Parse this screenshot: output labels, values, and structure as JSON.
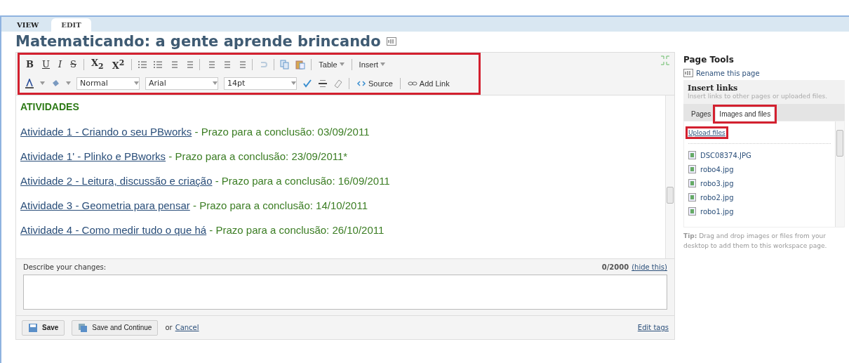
{
  "tabs": [
    {
      "label": "VIEW",
      "selected": false
    },
    {
      "label": "EDIT",
      "selected": true
    }
  ],
  "page_title": "Matematicando: a gente aprende brincando",
  "toolbar": {
    "highlighted": true,
    "format_buttons": [
      "B",
      "U",
      "I",
      "S"
    ],
    "script_buttons": [
      "X$_{2}$",
      "X$^{2}$"
    ],
    "menus": [
      "Table",
      "Insert"
    ],
    "selects": [
      {
        "value": "Normal"
      },
      {
        "value": "Arial"
      },
      {
        "value": "14pt"
      }
    ],
    "text_buttons": [
      "Source",
      "Add Link"
    ]
  },
  "content": {
    "heading": "ATIVIDADES",
    "activities": [
      {
        "link": "Atividade 1 - Criando o seu PBworks",
        "rest": " - Prazo para a conclusão: 03/09/2011"
      },
      {
        "link": "Atividade 1' - Plinko e PBworks",
        "rest": " - Prazo para a conclusão: 23/09/2011*"
      },
      {
        "link": "Atividade 2 - Leitura, discussão e criação",
        "rest": " -  Prazo para a conclusão: 16/09/2011"
      },
      {
        "link": "Atividade 3 - Geometria para pensar",
        "rest": " - Prazo para a conclusão: 14/10/2011"
      },
      {
        "link": "Atividade 4 - Como medir tudo o que há",
        "rest": " - Prazo para a conclusão: 26/10/2011"
      }
    ]
  },
  "changes": {
    "label": "Describe your changes:",
    "counter": "0/2000",
    "hide_link": "(hide this)"
  },
  "footer": {
    "save": "Save",
    "save_continue": "Save and Continue",
    "or": "or",
    "cancel": "Cancel",
    "edit_tags": "Edit tags"
  },
  "sidebar": {
    "title": "Page Tools",
    "rename": "Rename this page",
    "insert_title": "Insert links",
    "insert_hint": "Insert links to other pages or uploaded files.",
    "tabs": [
      {
        "label": "Pages",
        "selected": false,
        "highlighted": false
      },
      {
        "label": "Images and files",
        "selected": true,
        "highlighted": true
      }
    ],
    "upload": {
      "label": "Upload files",
      "highlighted": true
    },
    "files": [
      "DSC08374.JPG",
      "robo4.jpg",
      "robo3.jpg",
      "robo2.jpg",
      "robo1.jpg"
    ],
    "tip_label": "Tip:",
    "tip": "Drag and drop images or files from your desktop to add them to this workspace page."
  }
}
